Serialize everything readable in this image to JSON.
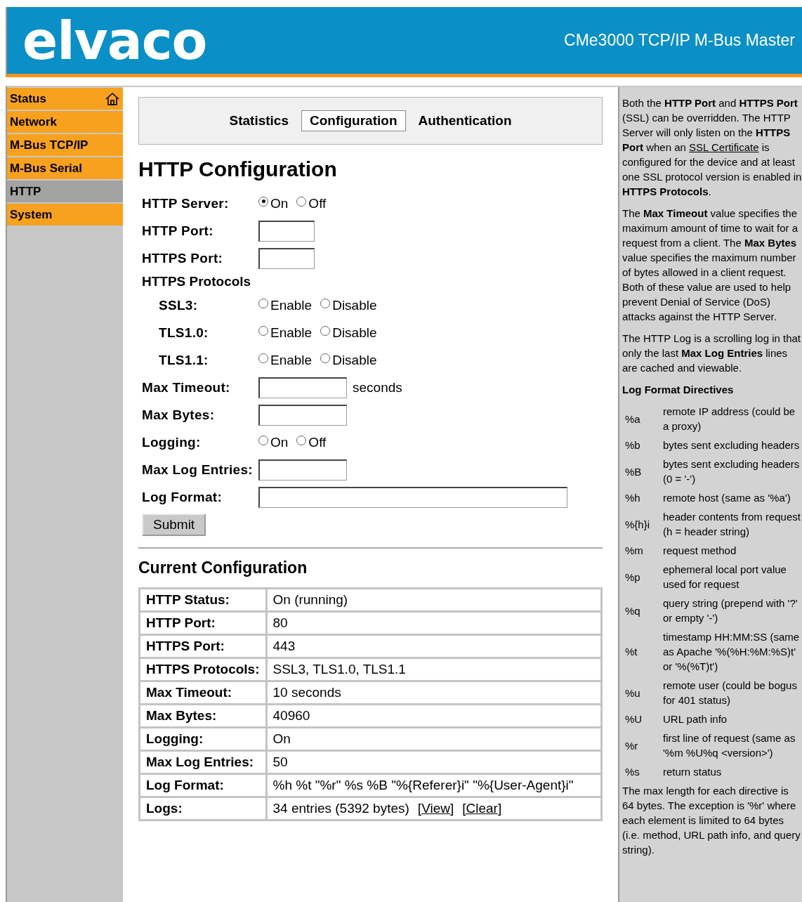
{
  "header": {
    "logo": "elvaco",
    "product": "CMe3000 TCP/IP M-Bus Master"
  },
  "sidebar": {
    "items": [
      {
        "label": "Status",
        "selected": false,
        "home": true
      },
      {
        "label": "Network",
        "selected": false
      },
      {
        "label": "M-Bus TCP/IP",
        "selected": false
      },
      {
        "label": "M-Bus Serial",
        "selected": false
      },
      {
        "label": "HTTP",
        "selected": true
      },
      {
        "label": "System",
        "selected": false
      }
    ]
  },
  "tabs": [
    {
      "label": "Statistics",
      "selected": false
    },
    {
      "label": "Configuration",
      "selected": true
    },
    {
      "label": "Authentication",
      "selected": false
    }
  ],
  "form": {
    "title": "HTTP Configuration",
    "rows": [
      {
        "kind": "radio",
        "label": "HTTP Server:",
        "options": [
          {
            "label": "On",
            "selected": true
          },
          {
            "label": "Off",
            "selected": false
          }
        ]
      },
      {
        "kind": "port",
        "label": "HTTP Port:"
      },
      {
        "kind": "port",
        "label": "HTTPS Port:"
      },
      {
        "kind": "group",
        "label": "HTTPS Protocols",
        "children": [
          {
            "kind": "radio",
            "label": "SSL3:",
            "options": [
              {
                "label": "Enable",
                "selected": false
              },
              {
                "label": "Disable",
                "selected": false
              }
            ]
          },
          {
            "kind": "radio",
            "label": "TLS1.0:",
            "options": [
              {
                "label": "Enable",
                "selected": false
              },
              {
                "label": "Disable",
                "selected": false
              }
            ]
          },
          {
            "kind": "radio",
            "label": "TLS1.1:",
            "options": [
              {
                "label": "Enable",
                "selected": false
              },
              {
                "label": "Disable",
                "selected": false
              }
            ]
          }
        ]
      },
      {
        "kind": "number",
        "label": "Max Timeout:",
        "suffix": "seconds"
      },
      {
        "kind": "number",
        "label": "Max Bytes:"
      },
      {
        "kind": "radio",
        "label": "Logging:",
        "options": [
          {
            "label": "On",
            "selected": false
          },
          {
            "label": "Off",
            "selected": false
          }
        ]
      },
      {
        "kind": "number",
        "label": "Max Log Entries:"
      },
      {
        "kind": "text",
        "label": "Log Format:"
      }
    ],
    "submit": "Submit"
  },
  "current": {
    "title": "Current Configuration",
    "rows": [
      {
        "label": "HTTP Status:",
        "value": "On (running)"
      },
      {
        "label": "HTTP Port:",
        "value": "80"
      },
      {
        "label": "HTTPS Port:",
        "value": "443"
      },
      {
        "label": "HTTPS Protocols:",
        "value": "SSL3, TLS1.0, TLS1.1"
      },
      {
        "label": "Max Timeout:",
        "value": "10 seconds"
      },
      {
        "label": "Max Bytes:",
        "value": "40960"
      },
      {
        "label": "Logging:",
        "value": "On"
      },
      {
        "label": "Max Log Entries:",
        "value": "50"
      },
      {
        "label": "Log Format:",
        "value": "%h %t \"%r\" %s %B \"%{Referer}i\" \"%{User-Agent}i\""
      },
      {
        "label": "Logs:",
        "value": "34 entries (5392 bytes)",
        "links": [
          "[View]",
          "[Clear]"
        ]
      }
    ]
  },
  "help": {
    "paragraphs": [
      [
        {
          "kind": "text",
          "text": "Both the **HTTP Port** and **HTTPS Port** (SSL) can be overridden. The HTTP Server will only listen on the **HTTPS Port** when an "
        },
        {
          "kind": "link",
          "text": "SSL Certificate"
        },
        {
          "kind": "text",
          "text": " is configured for the device and at least one SSL protocol version is enabled in **HTTPS Protocols**."
        }
      ],
      [
        {
          "kind": "text",
          "text": "The **Max Timeout** value specifies the maximum amount of time to wait for a request from a client. The **Max Bytes** value specifies the maximum number of bytes allowed in a client request. Both of these value are used to help prevent Denial of Service (DoS) attacks against the HTTP Server."
        }
      ],
      [
        {
          "kind": "text",
          "text": "The HTTP Log is a scrolling log in that only the last **Max Log Entries** lines are cached and viewable."
        }
      ]
    ],
    "directives_title": "Log Format Directives",
    "directives": [
      {
        "code": "%a",
        "text": "remote IP address (could be a proxy)"
      },
      {
        "code": "%b",
        "text": "bytes sent excluding headers"
      },
      {
        "code": "%B",
        "text": "bytes sent excluding headers (0 = '-')"
      },
      {
        "code": "%h",
        "text": "remote host (same as '%a')"
      },
      {
        "code": "%{h}i",
        "text": "header contents from request (h = header string)"
      },
      {
        "code": "%m",
        "text": "request method"
      },
      {
        "code": "%p",
        "text": "ephemeral local port value used for request"
      },
      {
        "code": "%q",
        "text": "query string (prepend with '?' or empty '-')"
      },
      {
        "code": "%t",
        "text": "timestamp HH:MM:SS (same as Apache '%(%H:%M:%S)t' or '%(%T)t')"
      },
      {
        "code": "%u",
        "text": "remote user (could be bogus for 401 status)"
      },
      {
        "code": "%U",
        "text": "URL path info"
      },
      {
        "code": "%r",
        "text": "first line of request (same as '%m %U%q <version>')"
      },
      {
        "code": "%s",
        "text": "return status"
      }
    ],
    "footer": "The max length for each directive is 64 bytes. The exception is '%r' where each element is limited to 64 bytes (i.e. method, URL path info, and query string)."
  }
}
